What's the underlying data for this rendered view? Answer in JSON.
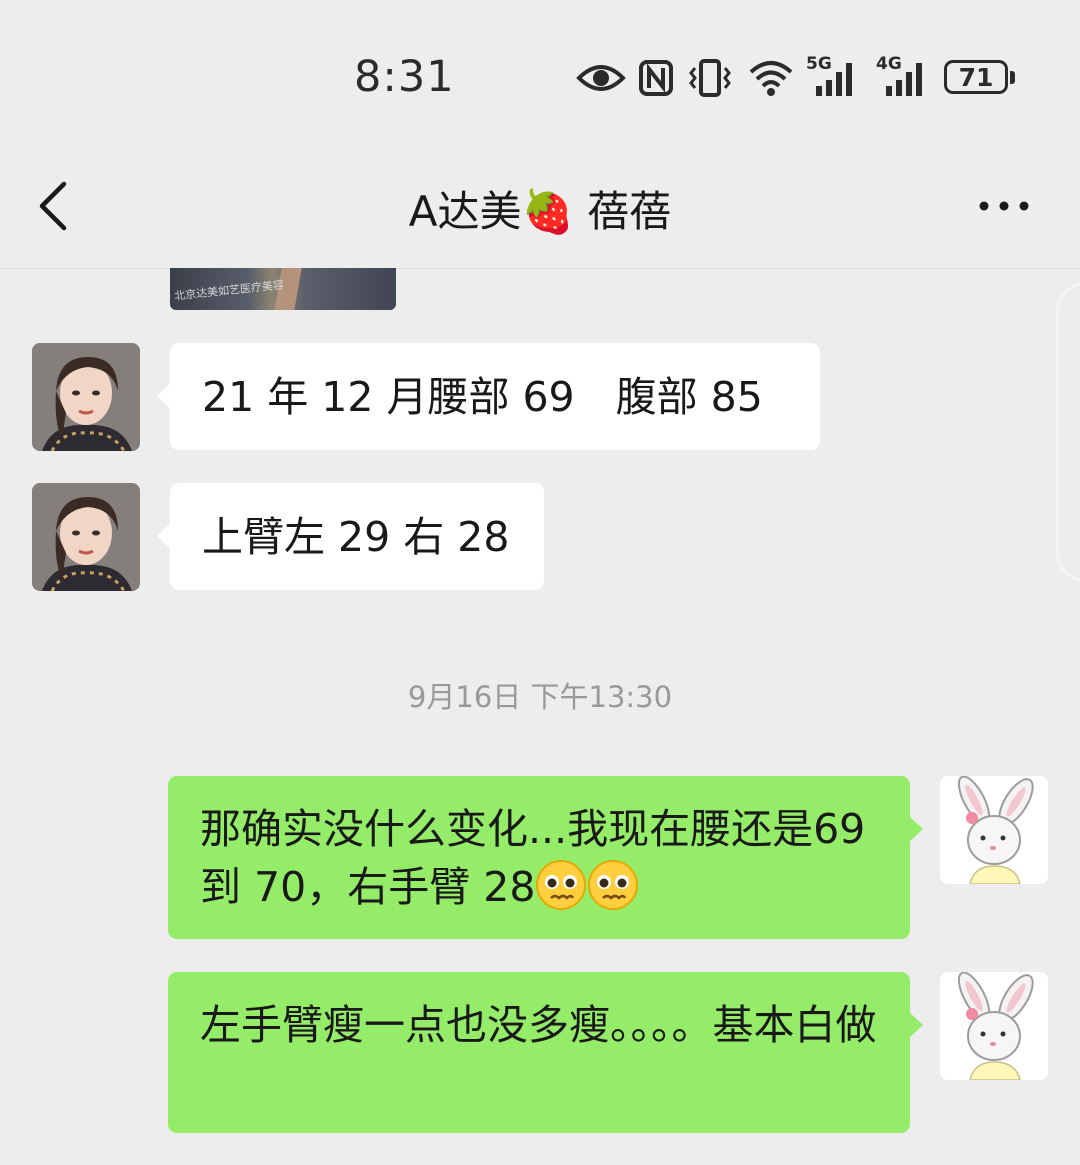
{
  "status_bar": {
    "time": "8:31",
    "battery_level": "71",
    "network_1": "5G",
    "network_2": "4G",
    "icons": [
      "eye-icon",
      "nfc-icon",
      "vibrate-icon",
      "wifi-icon",
      "signal-5g-icon",
      "signal-4g-icon",
      "battery-icon"
    ]
  },
  "nav": {
    "title": "A达美🍓 蓓蓓",
    "back_icon": "chevron-left-icon",
    "more_icon": "more-dots-icon"
  },
  "chat": {
    "photo_thumbnail_text": "北京达美如艺医疗美容",
    "messages": [
      {
        "side": "incoming",
        "text": "21 年 12 月腰部 69　腹部 85"
      },
      {
        "side": "incoming",
        "text": "上臂左 29 右 28"
      },
      {
        "side": "outgoing",
        "text": "那确实没什么变化...我现在腰还是69 到 70，右手臂 28"
      },
      {
        "side": "outgoing",
        "text": "左手臂瘦一点也没多瘦。。。。基本白做"
      }
    ],
    "timestamp": "9月16日 下午13:30"
  },
  "colors": {
    "background": "#ededed",
    "incoming_bubble": "#ffffff",
    "outgoing_bubble": "#95ec69",
    "timestamp_text": "#999999"
  }
}
